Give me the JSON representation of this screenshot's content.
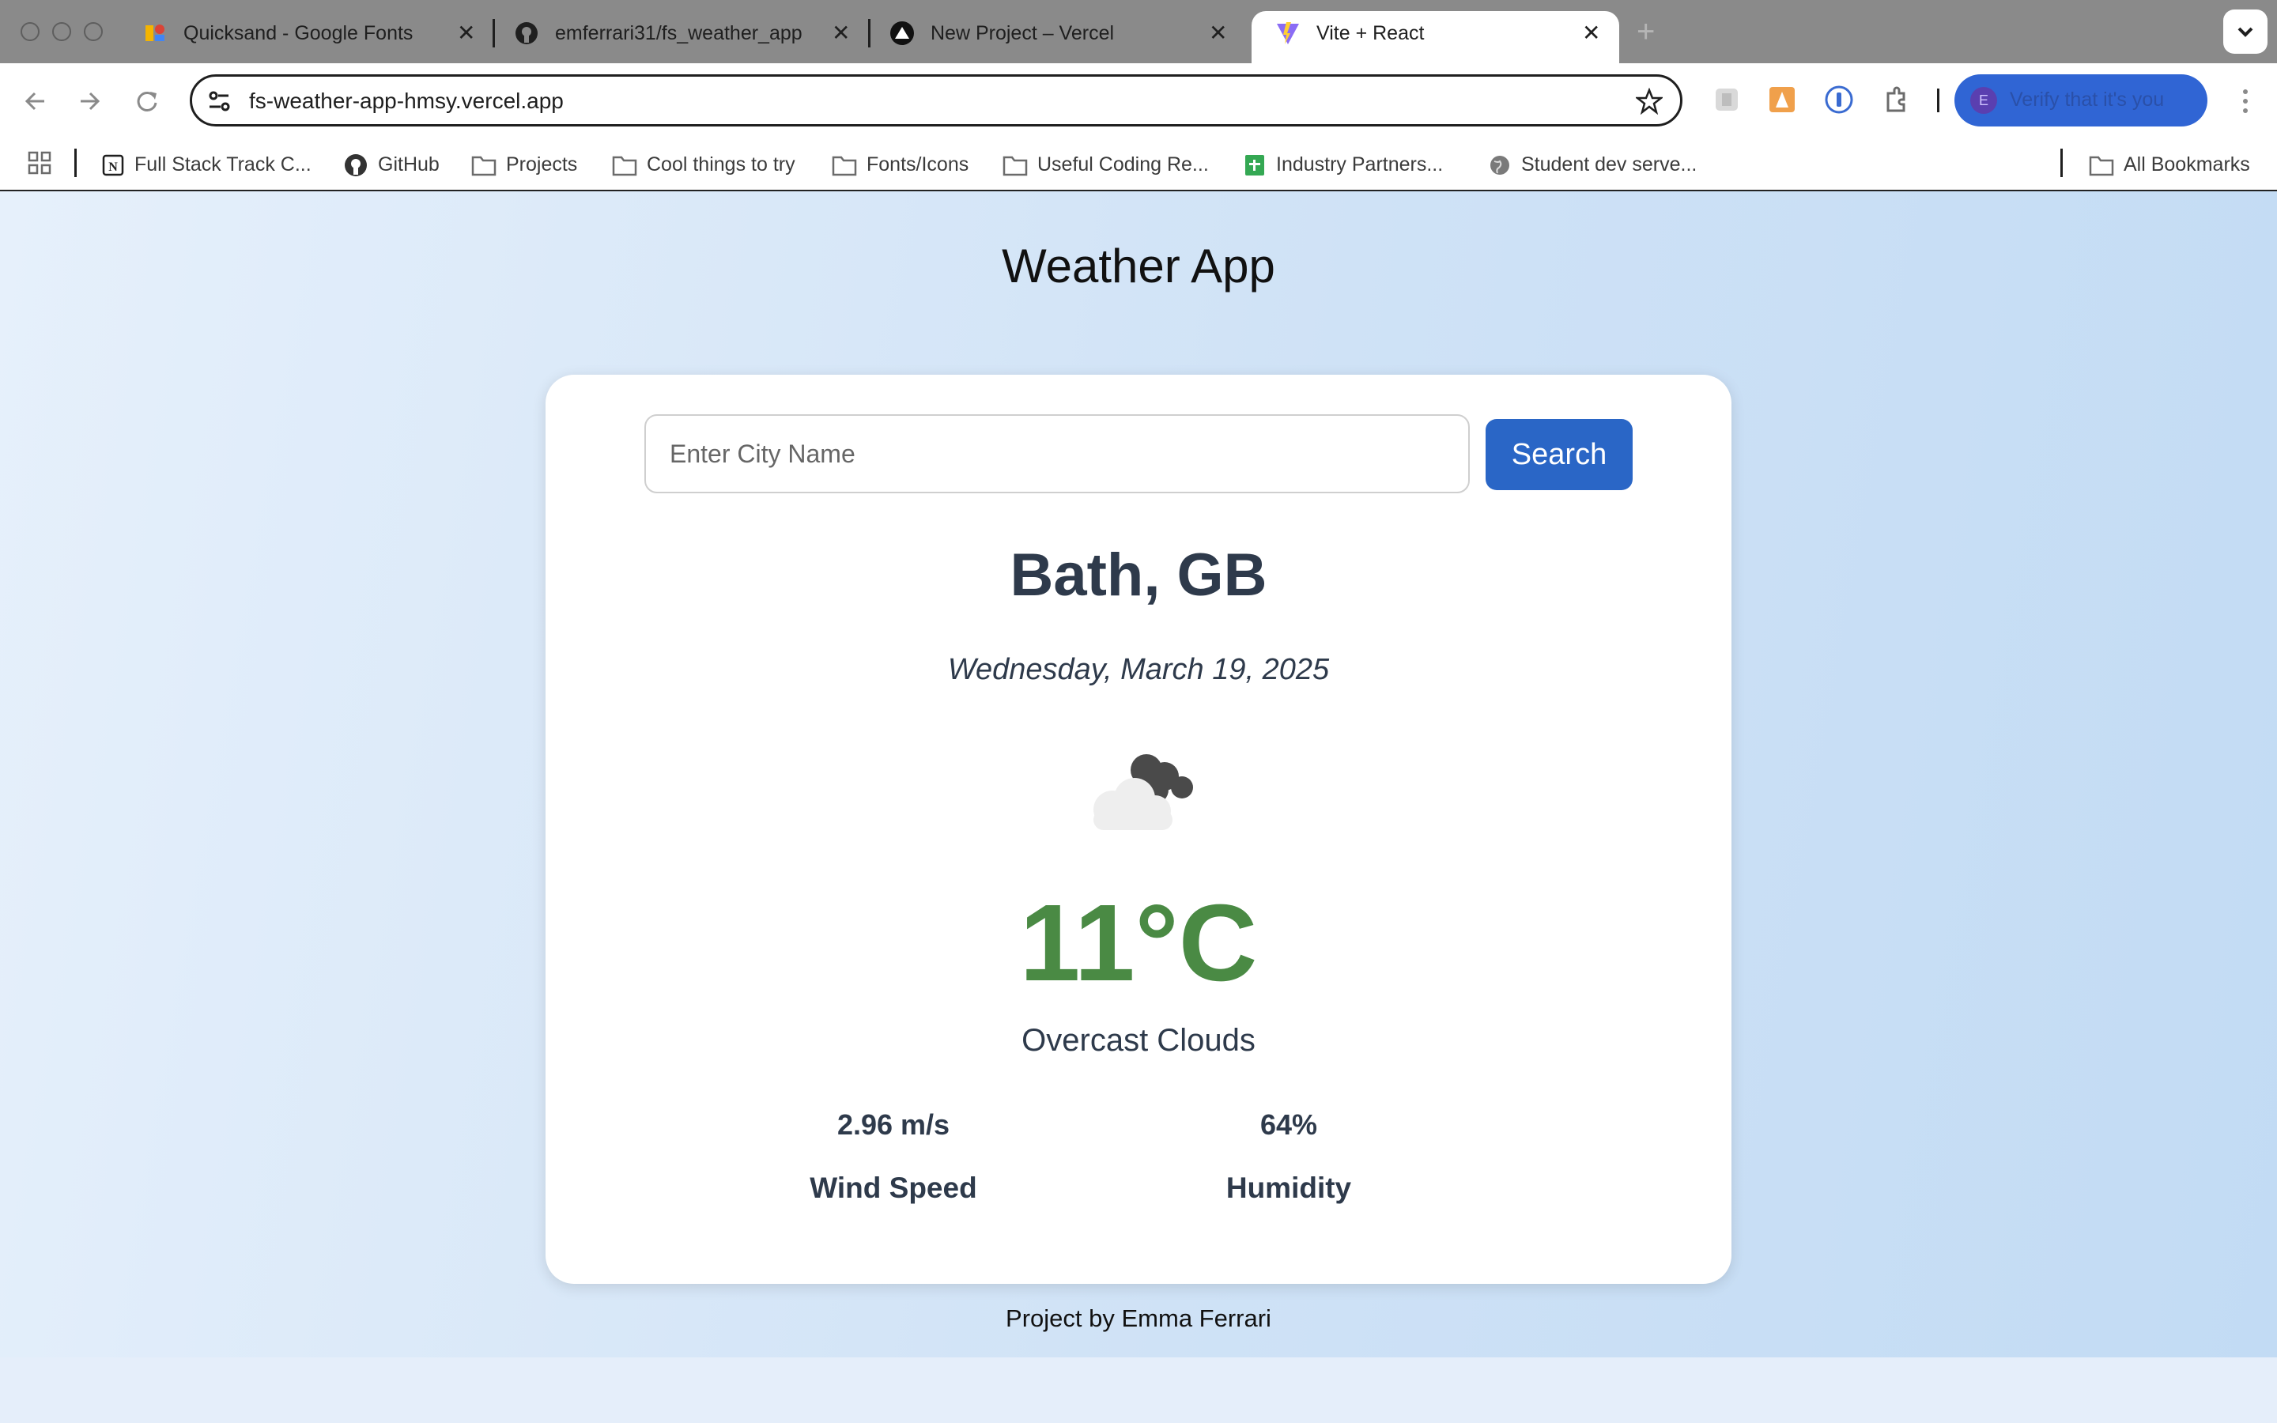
{
  "browser": {
    "tabs": [
      {
        "title": "Quicksand - Google Fonts",
        "icon": "google-fonts-icon"
      },
      {
        "title": "emferrari31/fs_weather_app",
        "icon": "github-icon"
      },
      {
        "title": "New Project – Vercel",
        "icon": "vercel-icon"
      },
      {
        "title": "Vite + React",
        "icon": "vite-icon",
        "active": true
      }
    ],
    "url": "fs-weather-app-hmsy.vercel.app",
    "profile_text": "Verify that it's you",
    "profile_initial": "E",
    "bookmarks": [
      {
        "label": "Full Stack Track C...",
        "icon": "notion-icon"
      },
      {
        "label": "GitHub",
        "icon": "github-icon"
      },
      {
        "label": "Projects",
        "icon": "folder-icon"
      },
      {
        "label": "Cool things to try",
        "icon": "folder-icon"
      },
      {
        "label": "Fonts/Icons",
        "icon": "folder-icon"
      },
      {
        "label": "Useful Coding Re...",
        "icon": "folder-icon"
      },
      {
        "label": "Industry Partners...",
        "icon": "sheets-icon"
      },
      {
        "label": "Student dev serve...",
        "icon": "globe-icon"
      }
    ],
    "all_bookmarks": "All Bookmarks"
  },
  "app": {
    "title": "Weather App",
    "search": {
      "placeholder": "Enter City Name",
      "button": "Search"
    },
    "city": "Bath, GB",
    "date": "Wednesday, March 19, 2025",
    "weather_icon": "overcast-clouds-icon",
    "temperature": "11°C",
    "description": "Overcast Clouds",
    "stats": [
      {
        "value": "2.96 m/s",
        "label": "Wind Speed"
      },
      {
        "value": "64%",
        "label": "Humidity"
      }
    ],
    "footer": "Project by Emma Ferrari"
  },
  "colors": {
    "accent": "#2a66c6",
    "temperature": "#4a8a44",
    "text": "#2e3a4b"
  }
}
